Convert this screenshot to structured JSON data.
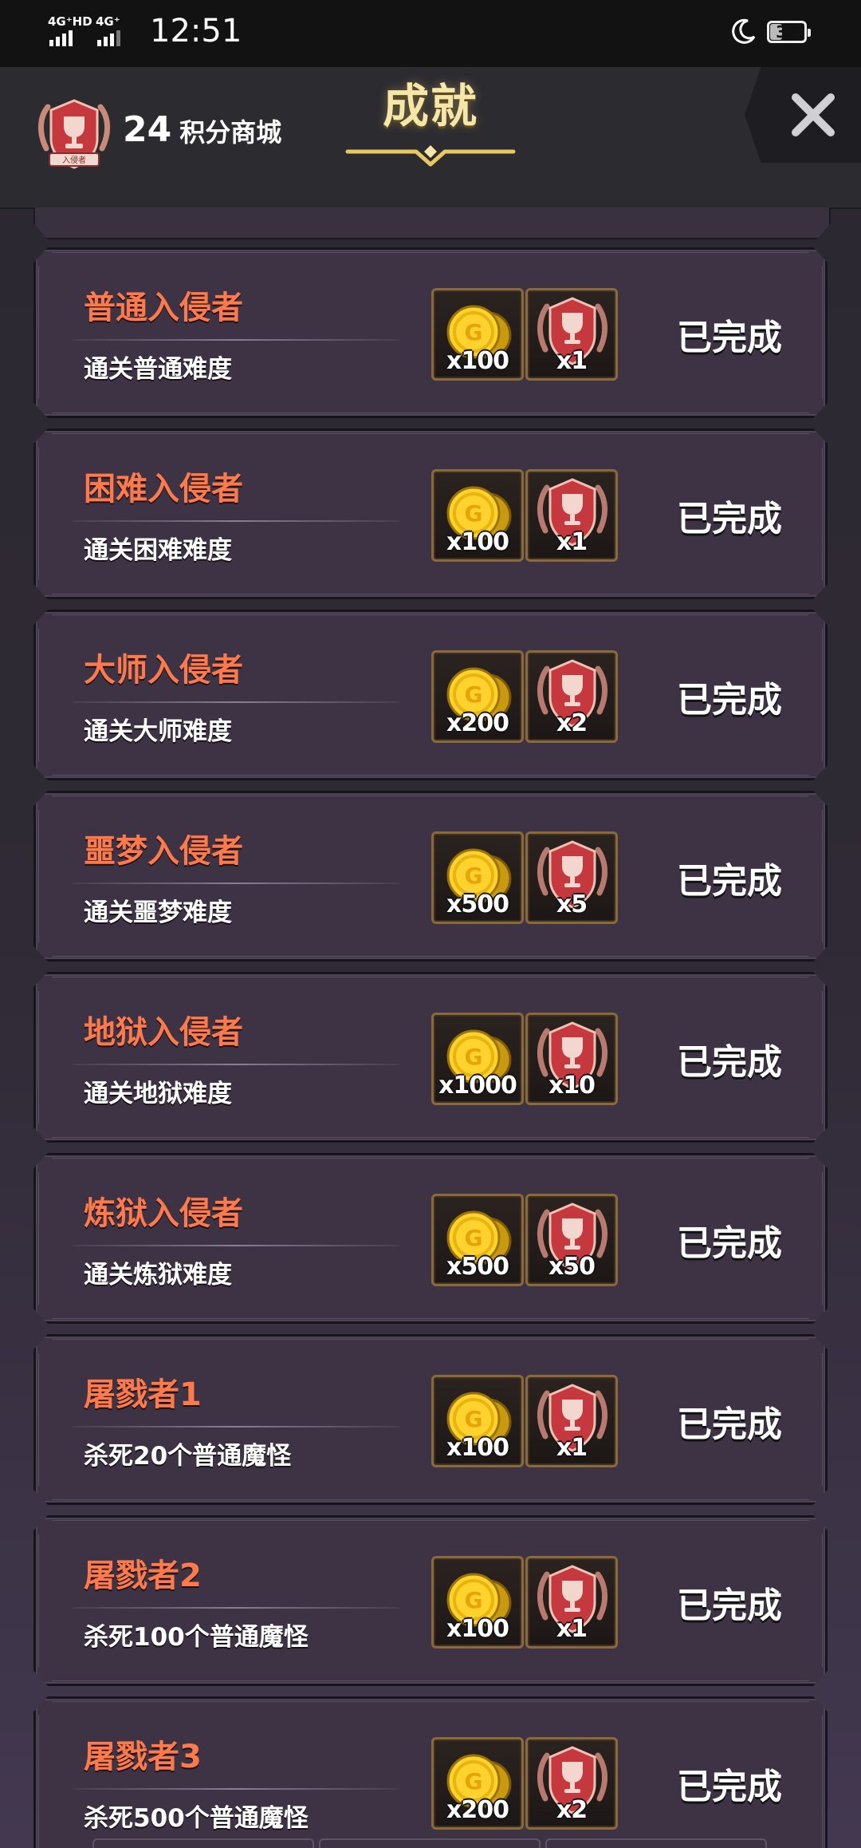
{
  "status_bar": {
    "signal1": "4G⁺HD",
    "signal2": "4G⁺",
    "time": "12:51",
    "battery": "33"
  },
  "header": {
    "badge_text": "入侵者",
    "points": "24",
    "shop_label": "积分商城",
    "title": "成就",
    "close_icon": "close-icon"
  },
  "colors": {
    "achievement_name": "#ff7a4a",
    "title": "#f6e6a8",
    "card_bg": "#3d3345",
    "reward_frame": "#8a6a3a"
  },
  "achievements": [
    {
      "name": "普通入侵者",
      "desc": "通关普通难度",
      "gold": "x100",
      "trophy": "x1",
      "status": "已完成"
    },
    {
      "name": "困难入侵者",
      "desc": "通关困难难度",
      "gold": "x100",
      "trophy": "x1",
      "status": "已完成"
    },
    {
      "name": "大师入侵者",
      "desc": "通关大师难度",
      "gold": "x200",
      "trophy": "x2",
      "status": "已完成"
    },
    {
      "name": "噩梦入侵者",
      "desc": "通关噩梦难度",
      "gold": "x500",
      "trophy": "x5",
      "status": "已完成"
    },
    {
      "name": "地狱入侵者",
      "desc": "通关地狱难度",
      "gold": "x1000",
      "trophy": "x10",
      "status": "已完成"
    },
    {
      "name": "炼狱入侵者",
      "desc": "通关炼狱难度",
      "gold": "x500",
      "trophy": "x50",
      "status": "已完成"
    },
    {
      "name": "屠戮者1",
      "desc": "杀死20个普通魔怪",
      "gold": "x100",
      "trophy": "x1",
      "status": "已完成"
    },
    {
      "name": "屠戮者2",
      "desc": "杀死100个普通魔怪",
      "gold": "x100",
      "trophy": "x1",
      "status": "已完成"
    },
    {
      "name": "屠戮者3",
      "desc": "杀死500个普通魔怪",
      "gold": "x200",
      "trophy": "x2",
      "status": "已完成"
    }
  ],
  "reward_icons": {
    "gold": "gold-coin-icon",
    "trophy": "trophy-badge-icon"
  }
}
